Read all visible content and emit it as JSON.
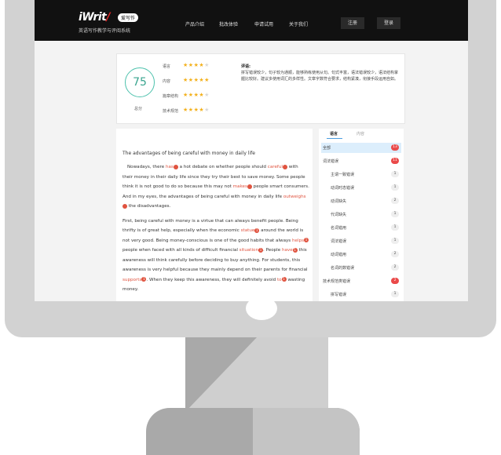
{
  "nav": {
    "logo_text": "iWrite",
    "badge": "爱写作",
    "tagline": "英语写作教学与评阅系统",
    "links": [
      "产品介绍",
      "批改体验",
      "申请试用",
      "关于我们"
    ],
    "buttons": [
      "注册",
      "登录"
    ]
  },
  "score": {
    "total_value": "75",
    "total_label": "总分",
    "categories": [
      {
        "label": "语言",
        "stars": 3.5
      },
      {
        "label": "内容",
        "stars": 4.5
      },
      {
        "label": "篇章结构",
        "stars": 3.5
      },
      {
        "label": "技术规范",
        "stars": 4
      }
    ],
    "review_title": "评语:",
    "review_text": "拼写错误较少，句子较为通顺，能够熟练使用从句。句式丰富，语法错误较少，语法结构掌握比较好。建议多使用词汇的多样性。文章字数符合要求，结构紧凑，衔接手段运用自如。"
  },
  "essay": {
    "title": "The advantages of being careful with money in daily life",
    "paragraphs": [
      [
        {
          "t": "Nowadays, there "
        },
        {
          "e": "has"
        },
        {
          "d": "1"
        },
        {
          "t": " a hot debate on whether people should "
        },
        {
          "e": "careful"
        },
        {
          "d": "1"
        },
        {
          "t": " with their money in their daily life since they try their best to save money. Some people think it is not good to do so because this may not "
        },
        {
          "e": "makes"
        },
        {
          "d": "1"
        },
        {
          "t": " people smart consumers. And in my eyes, the advantages of being careful with money in daily life "
        },
        {
          "e": "outweighs"
        },
        {
          "d": "1"
        },
        {
          "t": " the disadvantages."
        }
      ],
      [
        {
          "t": "First, being careful with money is a virtue that can always benefit people. Being thrifty is of great help, especially when the economic "
        },
        {
          "e": "statue"
        },
        {
          "d": "1"
        },
        {
          "t": " around the world is not very good. Being money-conscious is one of the good habits that always "
        },
        {
          "e": "helps"
        },
        {
          "d": "1"
        },
        {
          "t": " people when faced with all kinds of difficult financial "
        },
        {
          "e": "situation"
        },
        {
          "d": "1"
        },
        {
          "t": ". People "
        },
        {
          "e": "have"
        },
        {
          "d": "1"
        },
        {
          "t": " this awareness will think carefully before deciding to buy anything. For students, this awareness is very helpful because they mainly depend on their parents for financial "
        },
        {
          "e": "supports"
        },
        {
          "d": "1"
        },
        {
          "t": ". When they keep this awareness, they will definitely avoid "
        },
        {
          "e": "to"
        },
        {
          "d": "1"
        },
        {
          "t": " wasting money."
        }
      ]
    ]
  },
  "sidebar": {
    "tabs": [
      "语言",
      "内容"
    ],
    "items": [
      {
        "label": "全部",
        "count": "13",
        "style": "red",
        "indent": false,
        "active": true
      },
      {
        "label": "词法错误",
        "count": "11",
        "style": "red",
        "indent": false,
        "active": false
      },
      {
        "label": "主谓一致错误",
        "count": "1",
        "style": "grey",
        "indent": true,
        "active": false
      },
      {
        "label": "动词时态错误",
        "count": "1",
        "style": "grey",
        "indent": true,
        "active": false
      },
      {
        "label": "动词缺失",
        "count": "2",
        "style": "grey",
        "indent": true,
        "active": false
      },
      {
        "label": "代词缺失",
        "count": "1",
        "style": "grey",
        "indent": true,
        "active": false
      },
      {
        "label": "名词错用",
        "count": "1",
        "style": "grey",
        "indent": true,
        "active": false
      },
      {
        "label": "词法错误",
        "count": "1",
        "style": "grey",
        "indent": true,
        "active": false
      },
      {
        "label": "动词错用",
        "count": "2",
        "style": "grey",
        "indent": true,
        "active": false
      },
      {
        "label": "名词的数错误",
        "count": "2",
        "style": "grey",
        "indent": true,
        "active": false
      },
      {
        "label": "技术规范类错误",
        "count": "2",
        "style": "red",
        "indent": false,
        "active": false
      },
      {
        "label": "拼写错误",
        "count": "1",
        "style": "grey",
        "indent": true,
        "active": false
      }
    ]
  }
}
